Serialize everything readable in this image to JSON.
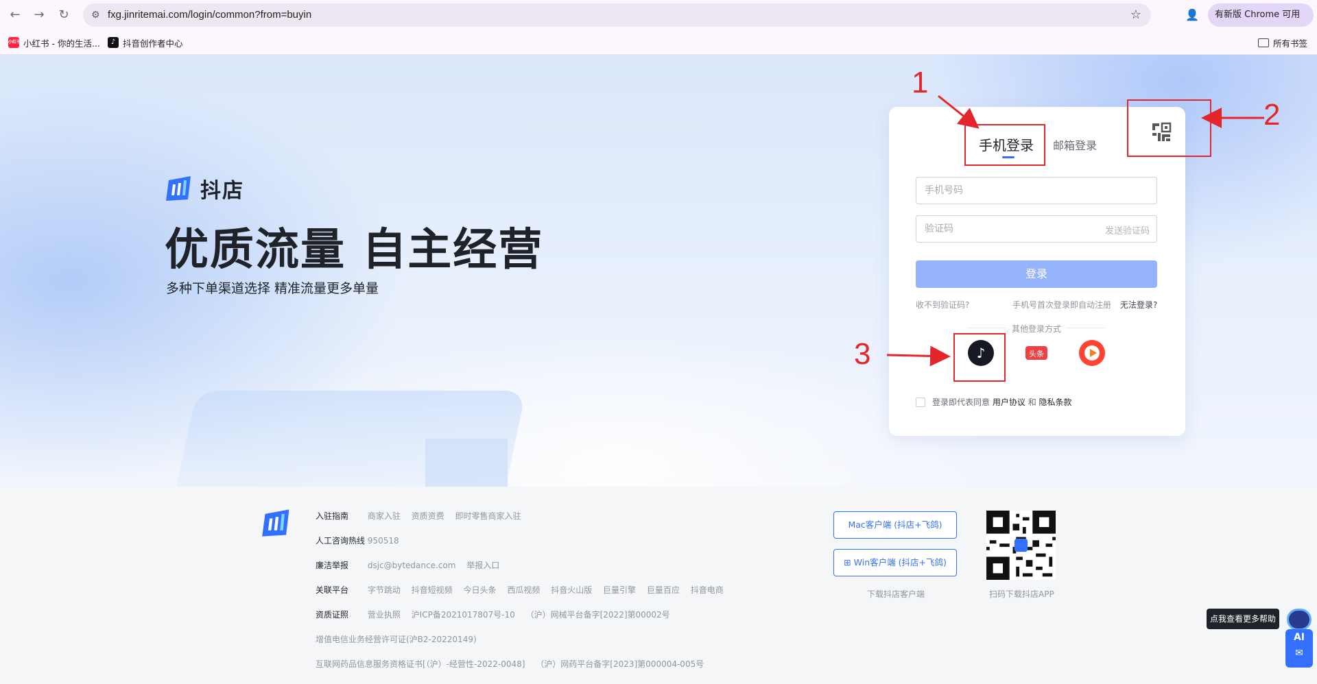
{
  "browser": {
    "url": "fxg.jinritemai.com/login/common?from=buyin",
    "update_label": "有新版 Chrome 可用",
    "bookmarks": [
      {
        "label": "小红书 - 你的生活..."
      },
      {
        "label": "抖音创作者中心"
      }
    ],
    "all_bookmarks": "所有书签",
    "xhs_icon_text": "小红书"
  },
  "hero": {
    "brand": "抖店",
    "title": "优质流量 自主经营",
    "subtitle": "多种下单渠道选择 精准流量更多单量"
  },
  "login": {
    "tab_phone": "手机登录",
    "tab_email": "邮箱登录",
    "phone_placeholder": "手机号码",
    "code_placeholder": "验证码",
    "send_code": "发送验证码",
    "submit": "登录",
    "no_code": "收不到验证码?",
    "auto_register": "手机号首次登录即自动注册",
    "cant_login": "无法登录?",
    "other_methods": "其他登录方式",
    "toutiao_text": "头条",
    "agree_prefix": "登录即代表同意",
    "user_agreement": "用户协议",
    "and": "和",
    "privacy": "隐私条款"
  },
  "annotations": {
    "n1": "1",
    "n2": "2",
    "n3": "3",
    "color": "#e2262b"
  },
  "footer": {
    "rows": [
      {
        "label": "入驻指南",
        "items": [
          "商家入驻",
          "资质资费",
          "即时零售商家入驻"
        ]
      },
      {
        "label": "人工咨询热线",
        "items": [
          "950518"
        ]
      },
      {
        "label": "廉洁举报",
        "items": [
          "dsjc@bytedance.com",
          "举报入口"
        ]
      },
      {
        "label": "关联平台",
        "items": [
          "字节跳动",
          "抖音短视频",
          "今日头条",
          "西瓜视频",
          "抖音火山版",
          "巨量引擎",
          "巨量百应",
          "抖音电商"
        ]
      },
      {
        "label": "资质证照",
        "items": [
          "营业执照",
          "沪ICP备2021017807号-10",
          "（沪）网械平台备字[2022]第00002号"
        ]
      }
    ],
    "license_1": "增值电信业务经营许可证(沪B2-20220149)",
    "license_2": "互联网药品信息服务资格证书[（沪）-经营性-2022-0048]",
    "license_3": "（沪）网药平台备字[2023]第000004-005号",
    "mac_client": "Mac客户端 (抖店+飞鸽)",
    "win_client": "Win客户端 (抖店+飞鸽)",
    "download_client": "下载抖店客户端",
    "scan_download": "扫码下载抖店APP"
  },
  "helper": {
    "tip": "点我查看更多帮助",
    "ai": "AI"
  },
  "colors": {
    "brand_blue": "#3370ff",
    "login_btn": "#94b3fa"
  }
}
